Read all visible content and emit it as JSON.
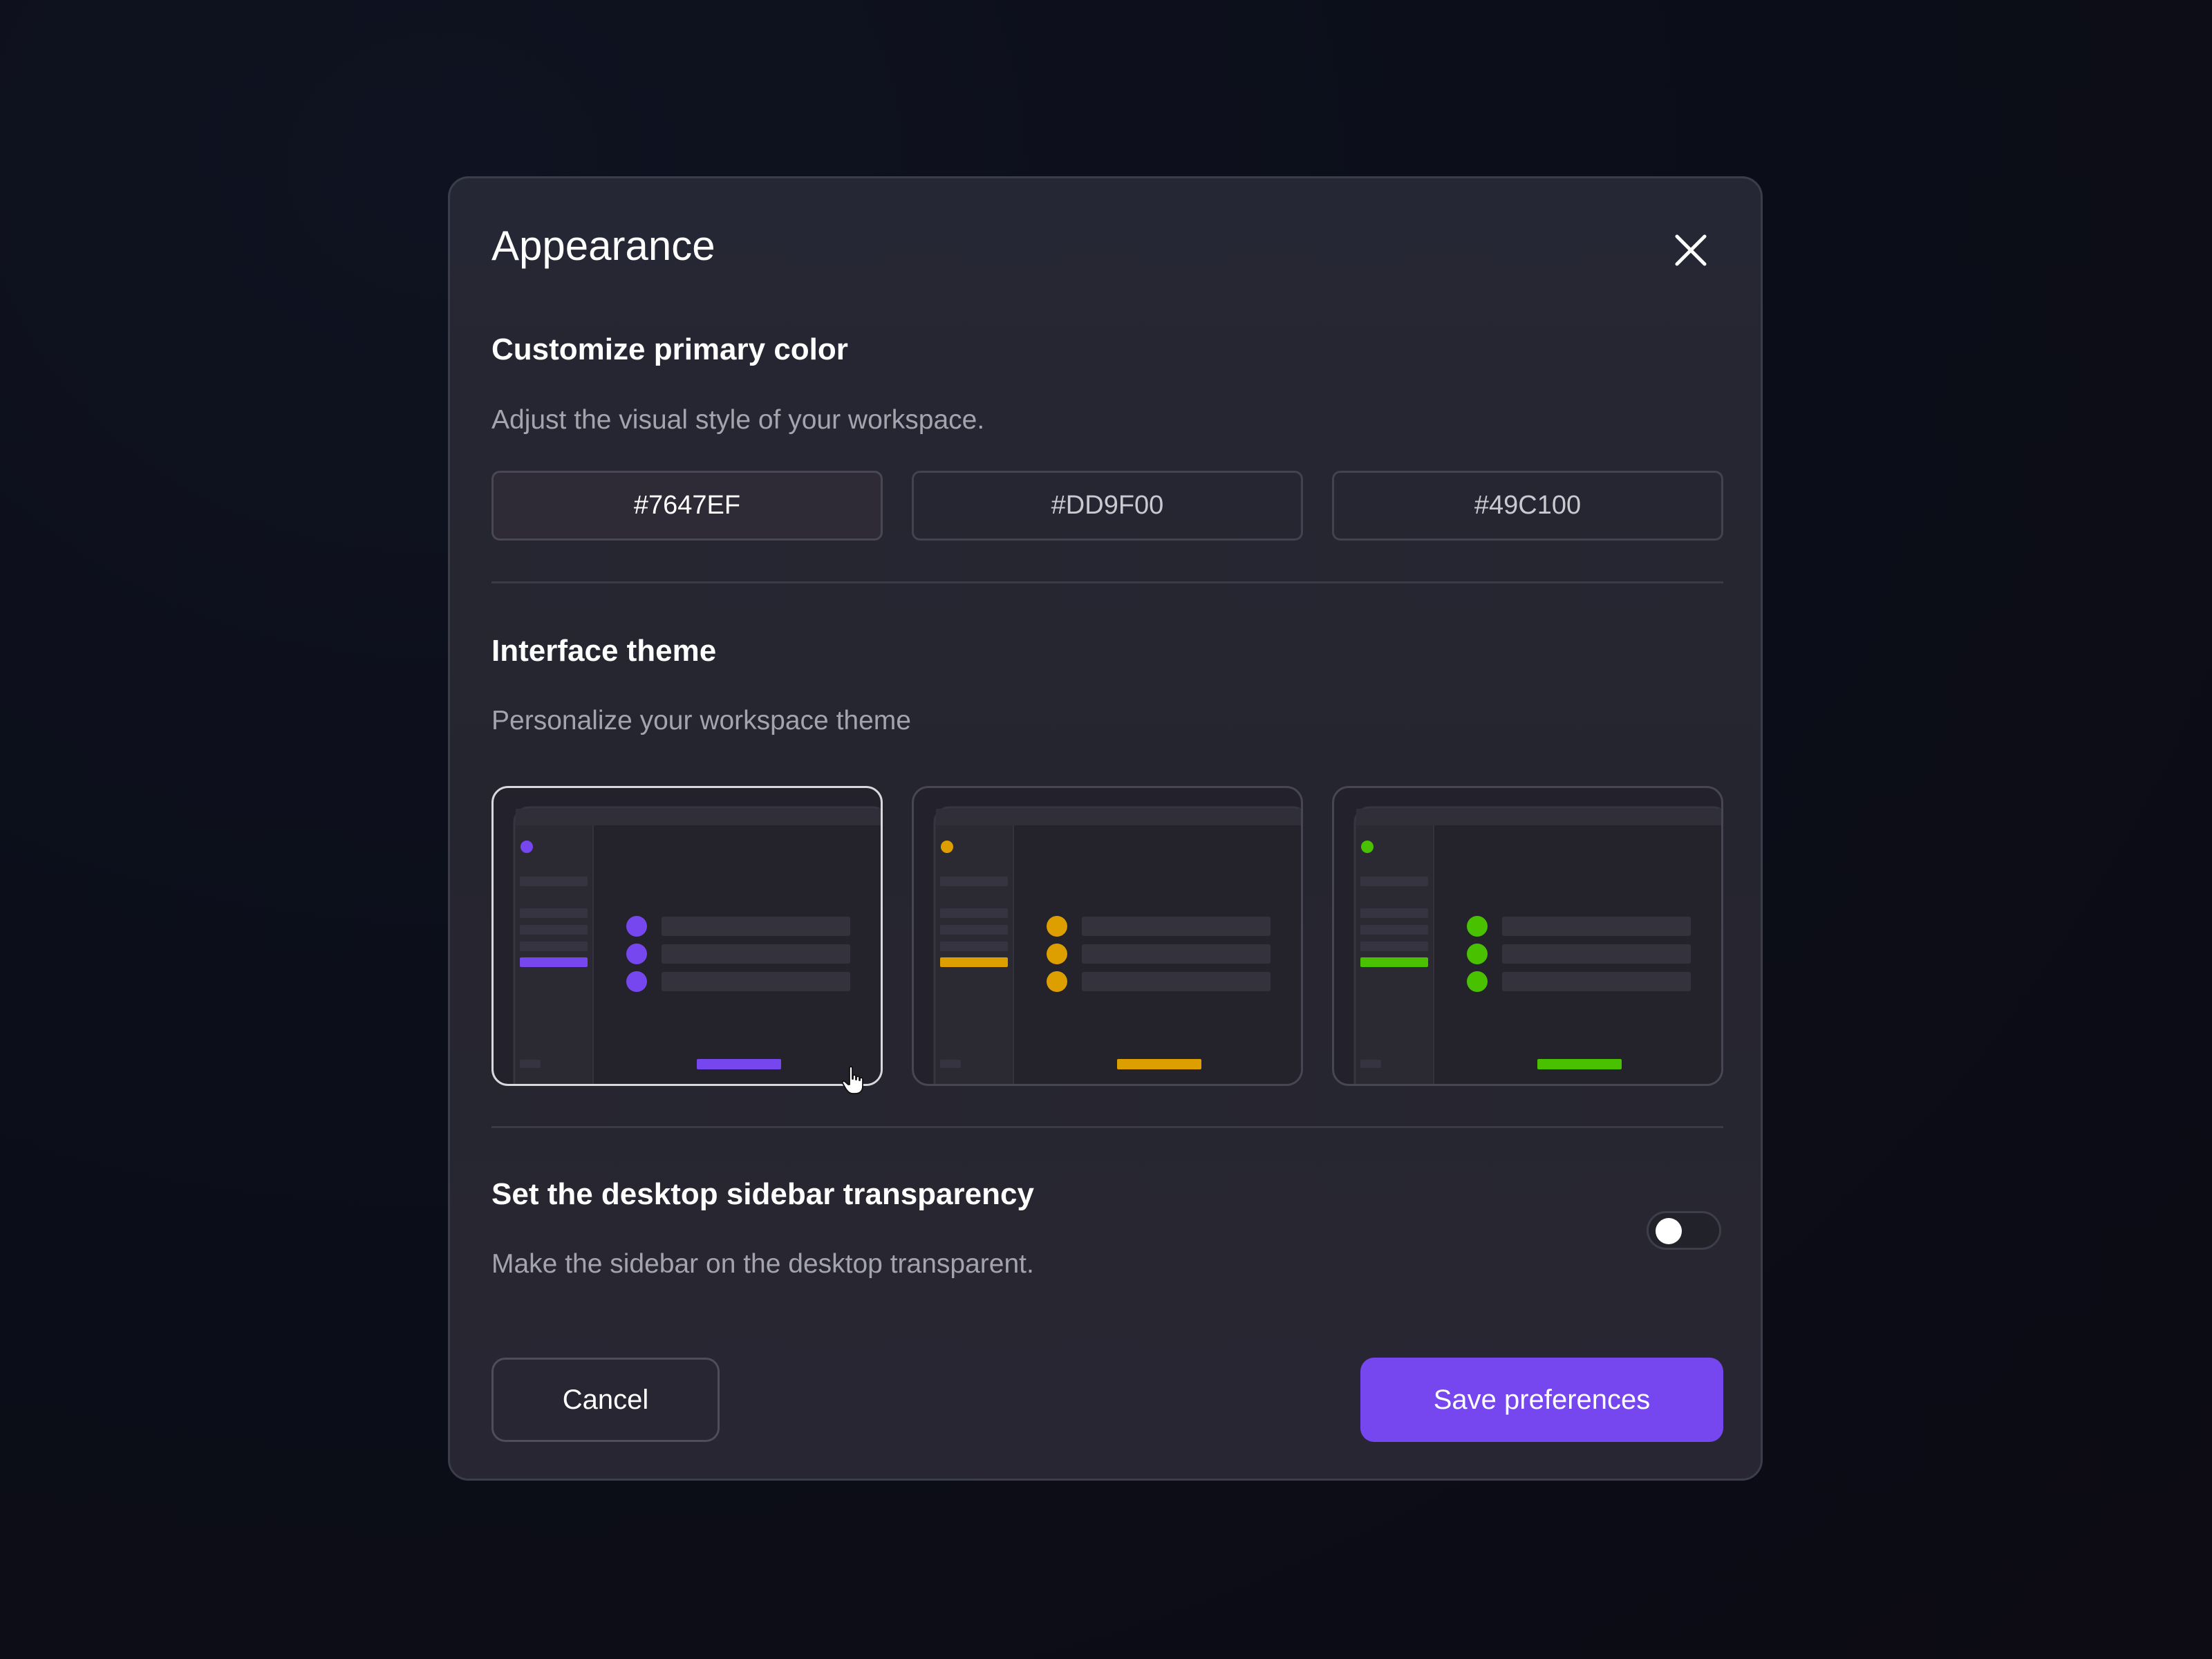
{
  "dialog": {
    "title": "Appearance",
    "close_icon": "close-icon"
  },
  "primary_color": {
    "title": "Customize primary color",
    "description": "Adjust the visual style of your workspace.",
    "options": [
      {
        "label": "#7647EF",
        "color": "#7647EF",
        "selected": true
      },
      {
        "label": "#DD9F00",
        "color": "#DD9F00",
        "selected": false
      },
      {
        "label": "#49C100",
        "color": "#49C100",
        "selected": false
      }
    ]
  },
  "theme": {
    "title": "Interface theme",
    "description": "Personalize your workspace theme",
    "options": [
      {
        "accent": "#7647EF",
        "selected": true
      },
      {
        "accent": "#DD9F00",
        "selected": false
      },
      {
        "accent": "#49C100",
        "selected": false
      }
    ]
  },
  "sidebar_transparency": {
    "title": "Set the desktop sidebar transparency",
    "description": "Make the sidebar on the desktop transparent.",
    "enabled": false
  },
  "footer": {
    "cancel_label": "Cancel",
    "save_label": "Save preferences"
  },
  "colors": {
    "accent": "#7647EF",
    "background": "#0B0E18",
    "panel": "#262734",
    "muted_text": "#A3A4AD"
  }
}
